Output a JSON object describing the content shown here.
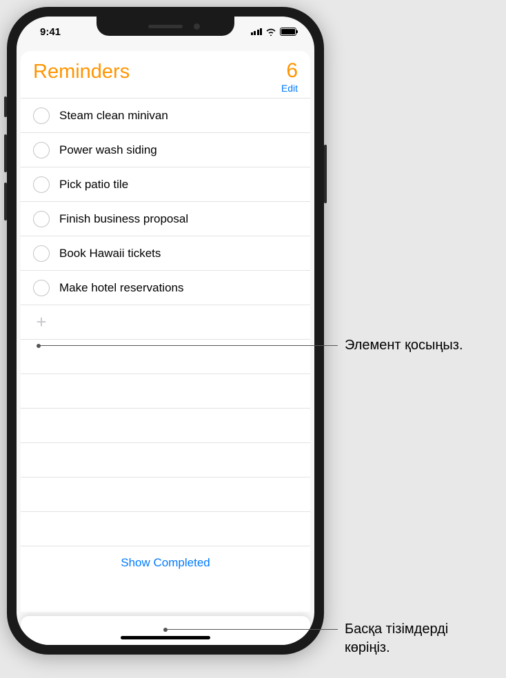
{
  "status_bar": {
    "time": "9:41"
  },
  "header": {
    "title": "Reminders",
    "count": "6",
    "edit_label": "Edit"
  },
  "reminders": [
    {
      "text": "Steam clean minivan"
    },
    {
      "text": "Power wash siding"
    },
    {
      "text": "Pick patio tile"
    },
    {
      "text": "Finish business proposal"
    },
    {
      "text": "Book Hawaii tickets"
    },
    {
      "text": "Make hotel reservations"
    }
  ],
  "footer": {
    "show_completed": "Show Completed"
  },
  "callouts": {
    "add_item": "Элемент қосыңыз.",
    "other_lists": "Басқа тізімдерді көріңіз."
  }
}
